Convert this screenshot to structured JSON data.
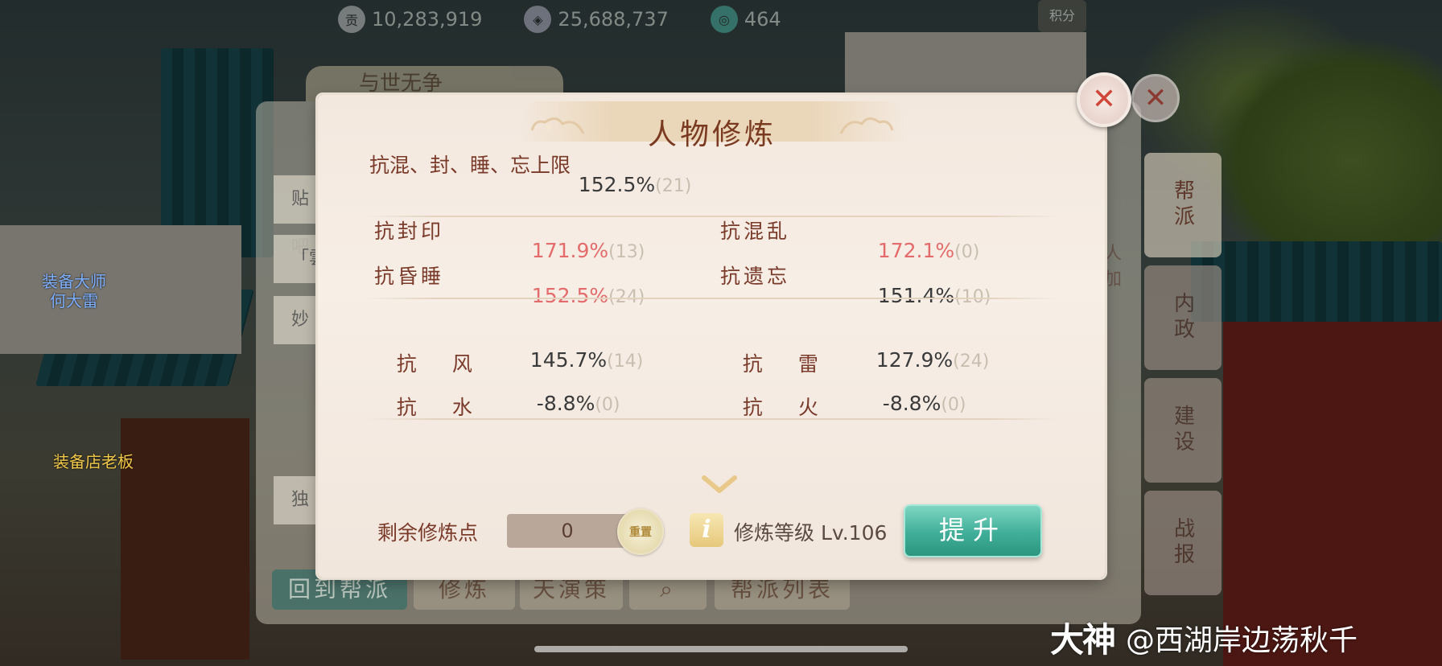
{
  "topbar": {
    "items": [
      {
        "icon": "coin-icon",
        "label": "贡",
        "value": "10,283,919"
      },
      {
        "icon": "silver-ingot-icon",
        "label": "",
        "value": "25,688,737"
      },
      {
        "icon": "jade-icon",
        "label": "",
        "value": "464"
      }
    ],
    "score_label": "积分"
  },
  "npcs": [
    {
      "name": "装备大师\n何大雷"
    },
    {
      "name": "装备店老板"
    }
  ],
  "underlying": {
    "title": "与世无争",
    "rows": [
      "贴吧",
      "「雲",
      "妙",
      "独"
    ],
    "side_tabs": [
      "帮派",
      "内政",
      "建设",
      "战报"
    ],
    "bottom_tabs": [
      "回到帮派",
      "修炼",
      "天演策",
      "帮派列表"
    ],
    "side_text": [
      "人",
      "加"
    ]
  },
  "dialog": {
    "title": "人物修炼",
    "cap_row": {
      "label": "抗混、封、睡、忘上限",
      "value": "152.5%",
      "points": "(21)"
    },
    "resist_rows": [
      {
        "label": "抗封印",
        "value": "171.9%",
        "points": "(13)",
        "highlight": true
      },
      {
        "label": "抗混乱",
        "value": "172.1%",
        "points": "(0)",
        "highlight": true
      },
      {
        "label": "抗昏睡",
        "value": "152.5%",
        "points": "(24)",
        "highlight": true
      },
      {
        "label": "抗遗忘",
        "value": "151.4%",
        "points": "(10)",
        "highlight": false
      }
    ],
    "element_rows": [
      {
        "label_a": "抗",
        "label_b": "风",
        "value": "145.7%",
        "points": "(14)"
      },
      {
        "label_a": "抗",
        "label_b": "雷",
        "value": "127.9%",
        "points": "(24)"
      },
      {
        "label_a": "抗",
        "label_b": "水",
        "value": "-8.8%",
        "points": "(0)"
      },
      {
        "label_a": "抗",
        "label_b": "火",
        "value": "-8.8%",
        "points": "(0)"
      }
    ],
    "footer": {
      "remaining_label": "剩余修炼点",
      "remaining_value": "0",
      "reset_label": "重置",
      "info_label": "i",
      "level_text": "修炼等级 Lv.106",
      "upgrade_label": "提升"
    }
  },
  "watermark": {
    "logo": "大神",
    "text": "@西湖岸边荡秋千"
  },
  "colors": {
    "highlight": "#e46b6b",
    "label": "#7a3a2a",
    "button": "#3fae98"
  }
}
